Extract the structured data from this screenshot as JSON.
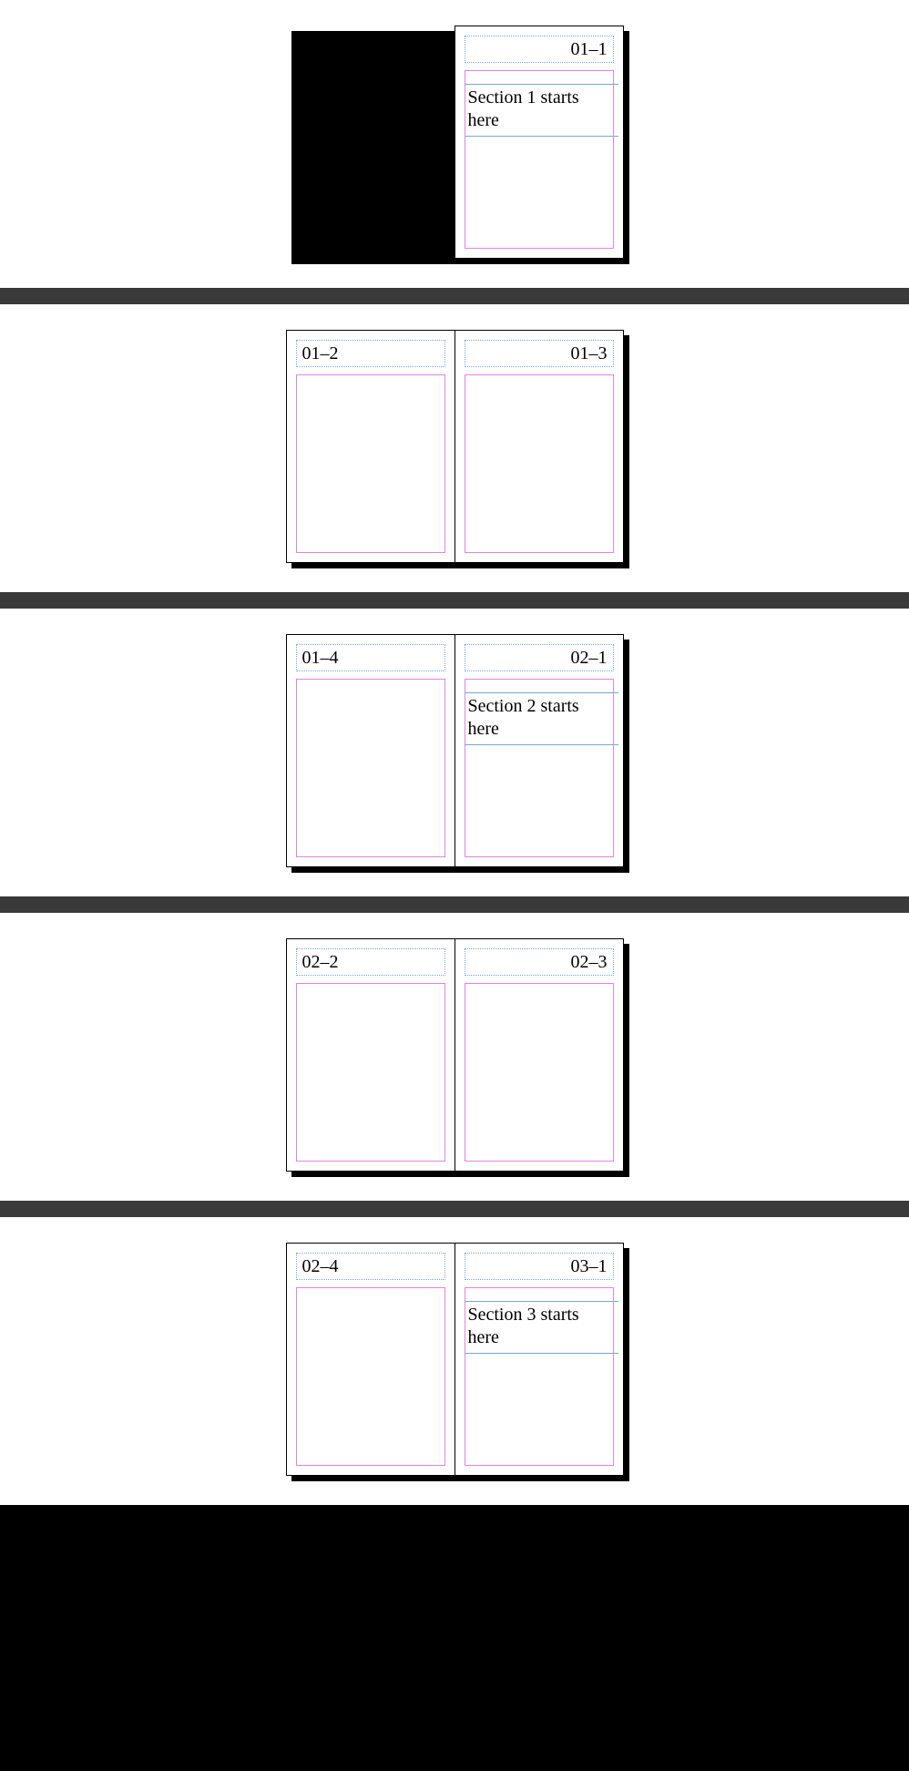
{
  "spreads": [
    {
      "left": {
        "placeholder": true
      },
      "right": {
        "num": "01–1",
        "align": "right",
        "text": "Section 1 starts here"
      }
    },
    {
      "left": {
        "num": "01–2",
        "align": "left"
      },
      "right": {
        "num": "01–3",
        "align": "right"
      }
    },
    {
      "left": {
        "num": "01–4",
        "align": "left"
      },
      "right": {
        "num": "02–1",
        "align": "right",
        "text": "Section 2 starts here"
      }
    },
    {
      "left": {
        "num": "02–2",
        "align": "left"
      },
      "right": {
        "num": "02–3",
        "align": "right"
      }
    },
    {
      "left": {
        "num": "02–4",
        "align": "left"
      },
      "right": {
        "num": "03–1",
        "align": "right",
        "text": "Section 3 starts here"
      }
    }
  ]
}
